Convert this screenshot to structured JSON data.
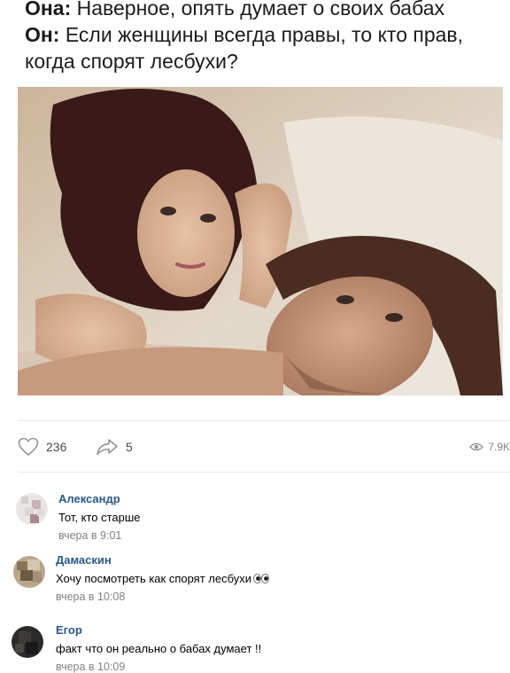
{
  "caption": {
    "line1_speaker": "Она:",
    "line1_text": " Наверное, опять думает о своих бабах",
    "line2_speaker": "Он:",
    "line2_text": " Если женщины всегда правы, то кто прав,",
    "line3_text": "когда спорят лесбухи?"
  },
  "post": {
    "likes": "236",
    "shares": "5",
    "views": "7.9K"
  },
  "icons": {
    "like": "heart-icon",
    "share": "share-arrow-icon",
    "views": "eye-icon"
  },
  "colors": {
    "author_link": "#2a5885",
    "icon_gray": "#909499",
    "time_gray": "#828282"
  },
  "comments": [
    {
      "author": "Александр",
      "text": "Тот, кто старше",
      "time": "вчера в 9:01"
    },
    {
      "author": "Дамаскин",
      "text": "Хочу посмотреть как спорят лесбухи",
      "time": "вчера в 10:08"
    },
    {
      "author": "Егор",
      "text": "факт что он реально о бабах думает !!",
      "time": "вчера в 10:09"
    }
  ]
}
